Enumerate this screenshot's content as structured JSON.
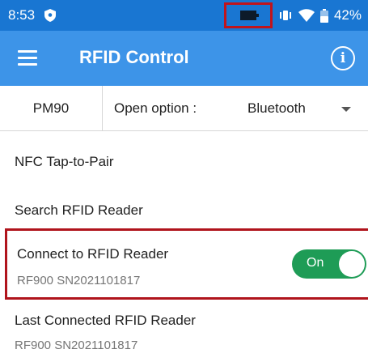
{
  "status_bar": {
    "time": "8:53",
    "battery_percent": "42%",
    "icons": [
      "shield-icon",
      "battery-saver-icon",
      "vibrate-icon",
      "wifi-icon",
      "battery-icon"
    ],
    "color": "#1976d2"
  },
  "app_bar": {
    "title": "RFID Control",
    "menu_icon": "hamburger-menu-icon",
    "info_icon": "info-icon",
    "info_symbol": "i",
    "color": "#3d94e8"
  },
  "option_row": {
    "device": "PM90",
    "label": "Open option :",
    "selected": "Bluetooth"
  },
  "list": {
    "nfc": "NFC Tap-to-Pair",
    "search": "Search RFID Reader",
    "connect": {
      "title": "Connect to RFID Reader",
      "subtitle": "RF900 SN2021101817",
      "toggle_label": "On",
      "toggle_color": "#1e9c56"
    },
    "last": {
      "title": "Last Connected RFID Reader",
      "subtitle": "RF900 SN2021101817"
    }
  },
  "highlight_color": "#b0141c"
}
